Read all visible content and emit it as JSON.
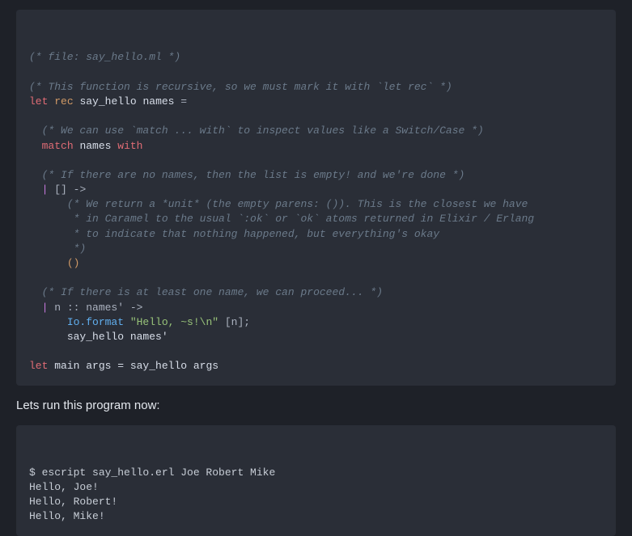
{
  "block1": {
    "c1": "(* file: say_hello.ml *)",
    "c2": "(* This function is recursive, so we must mark it with `let rec` *)",
    "kw_let": "let",
    "kw_rec": "rec",
    "fn_say": "say_hello",
    "id_names": "names",
    "eq": " =",
    "c3": "(* We can use `match ... with` to inspect values like a Switch/Case *)",
    "kw_match": "match",
    "kw_with": "with",
    "c4": "(* If there are no names, then the list is empty! and we're done *)",
    "pat_nil": "[] ->",
    "c5a": "(* We return a *unit* (the empty parens: ()). This is the closest we have",
    "c5b": " * in Caramel to the usual `:ok` or `ok` atoms returned in Elixir / Erlang",
    "c5c": " * to indicate that nothing happened, but everything's okay",
    "c5d": " *)",
    "unit": "()",
    "c6": "(* If there is at least one name, we can proceed... *)",
    "pipe": "|",
    "pat_cons": " n :: names' ->",
    "io_fmt": "Io.format ",
    "str": "\"Hello, ~s!\\n\"",
    "args_after": " [n];",
    "recur": "say_hello names'",
    "kw_let2": "let",
    "main_rest": " main args = say_hello args"
  },
  "prose1": "Lets run this program now:",
  "block2": {
    "l1": "$ escript say_hello.erl Joe Robert Mike",
    "l2": "Hello, Joe!",
    "l3": "Hello, Robert!",
    "l4": "Hello, Mike!"
  }
}
